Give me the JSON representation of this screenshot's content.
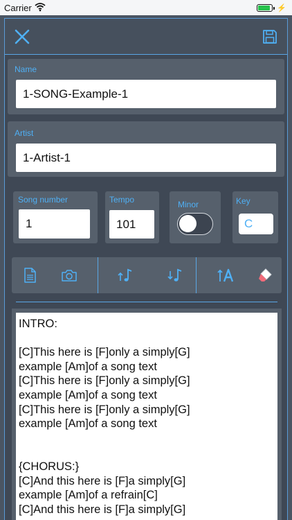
{
  "status": {
    "carrier": "Carrier"
  },
  "form": {
    "name_label": "Name",
    "name_value": "1-SONG-Example-1",
    "artist_label": "Artist",
    "artist_value": "1-Artist-1",
    "song_number_label": "Song number",
    "song_number_value": "1",
    "tempo_label": "Tempo",
    "tempo_value": "101",
    "minor_label": "Minor",
    "minor_on": false,
    "key_label": "Key",
    "key_value": "C"
  },
  "colors": {
    "accent": "#4fb0f5",
    "background": "#3f4855",
    "panel": "#56606c"
  },
  "icons": [
    "close-icon",
    "save-icon",
    "document-icon",
    "camera-icon",
    "transpose-up-icon",
    "transpose-down-icon",
    "text-size-icon",
    "eraser-icon"
  ],
  "lyrics": "INTRO:\n\n[C]This here is [F]only a simply[G]\nexample [Am]of a song text\n[C]This here is [F]only a simply[G]\nexample [Am]of a song text\n[C]This here is [F]only a simply[G]\nexample [Am]of a song text\n\n\n{CHORUS:}\n[C]And this here is [F]a simply[G]\nexample [Am]of a refrain[C]\n[C]And this here is [F]a simply[G]"
}
